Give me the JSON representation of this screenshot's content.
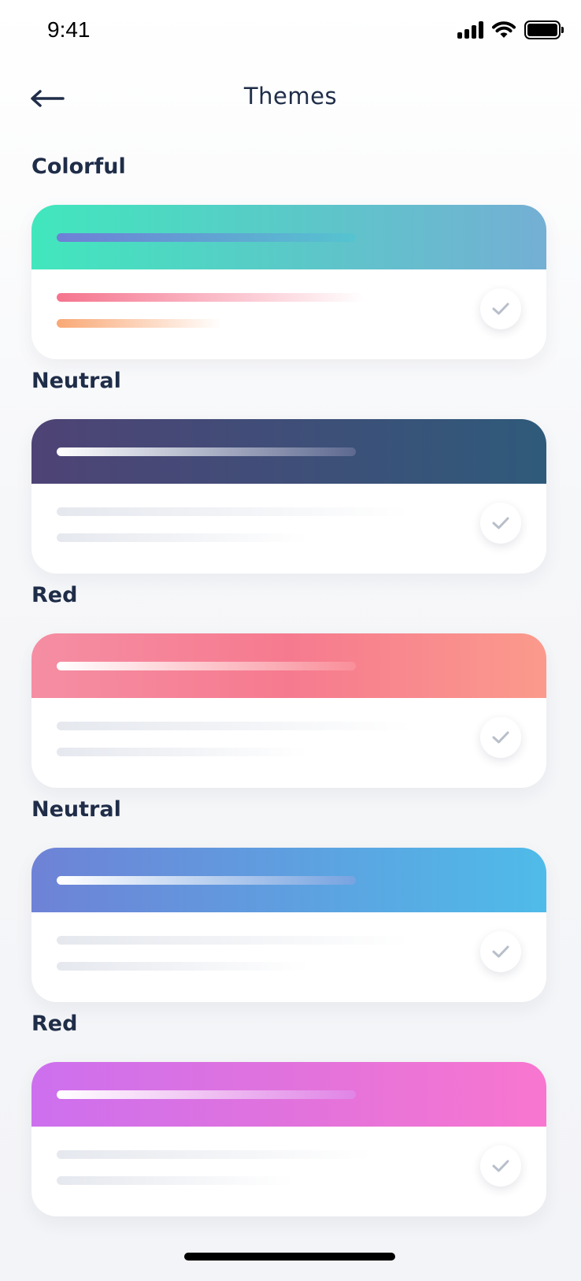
{
  "status_bar": {
    "time": "9:41"
  },
  "header": {
    "title": "Themes"
  },
  "themes": [
    {
      "label": "Colorful",
      "header_gradient": [
        "#41e7bd",
        "#5ac9c8",
        "#74afd4"
      ],
      "header_bar_gradient": [
        "#6f7fd6",
        "#55c4d0"
      ],
      "line1_gradient": [
        "#f5738d",
        "#ffffff"
      ],
      "line2_gradient": [
        "#f9a875",
        "#ffffff"
      ]
    },
    {
      "label": "Neutral",
      "header_gradient": [
        "#4e4375",
        "#3f4e78",
        "#2f5a7a"
      ],
      "header_bar_gradient": [
        "#ffffff",
        "#5d6990"
      ],
      "line1_gradient": [
        "#e5e8ee",
        "#ffffff"
      ],
      "line2_gradient": [
        "#e5e8ee",
        "#ffffff"
      ]
    },
    {
      "label": "Red",
      "header_gradient": [
        "#f58ea3",
        "#f67a8f",
        "#fb9a8c"
      ],
      "header_bar_gradient": [
        "#ffffff",
        "#f98f9a"
      ],
      "line1_gradient": [
        "#e5e8ee",
        "#ffffff"
      ],
      "line2_gradient": [
        "#e5e8ee",
        "#ffffff"
      ]
    },
    {
      "label": "Neutral",
      "header_gradient": [
        "#6e82d6",
        "#5e9fe0",
        "#4fbbe9"
      ],
      "header_bar_gradient": [
        "#ffffff",
        "#77a3e0"
      ],
      "line1_gradient": [
        "#e5e8ee",
        "#ffffff"
      ],
      "line2_gradient": [
        "#e5e8ee",
        "#ffffff"
      ]
    },
    {
      "label": "Red",
      "header_gradient": [
        "#cd70ee",
        "#e172dd",
        "#f876cf"
      ],
      "header_bar_gradient": [
        "#ffffff",
        "#e084e6"
      ],
      "line1_gradient": [
        "#e5e8ee",
        "#ffffff"
      ],
      "line2_gradient": [
        "#e5e8ee",
        "#ffffff"
      ]
    }
  ],
  "icons": {
    "back": "arrow-left-icon",
    "check": "check-icon",
    "check_color": "#b8bfca"
  }
}
